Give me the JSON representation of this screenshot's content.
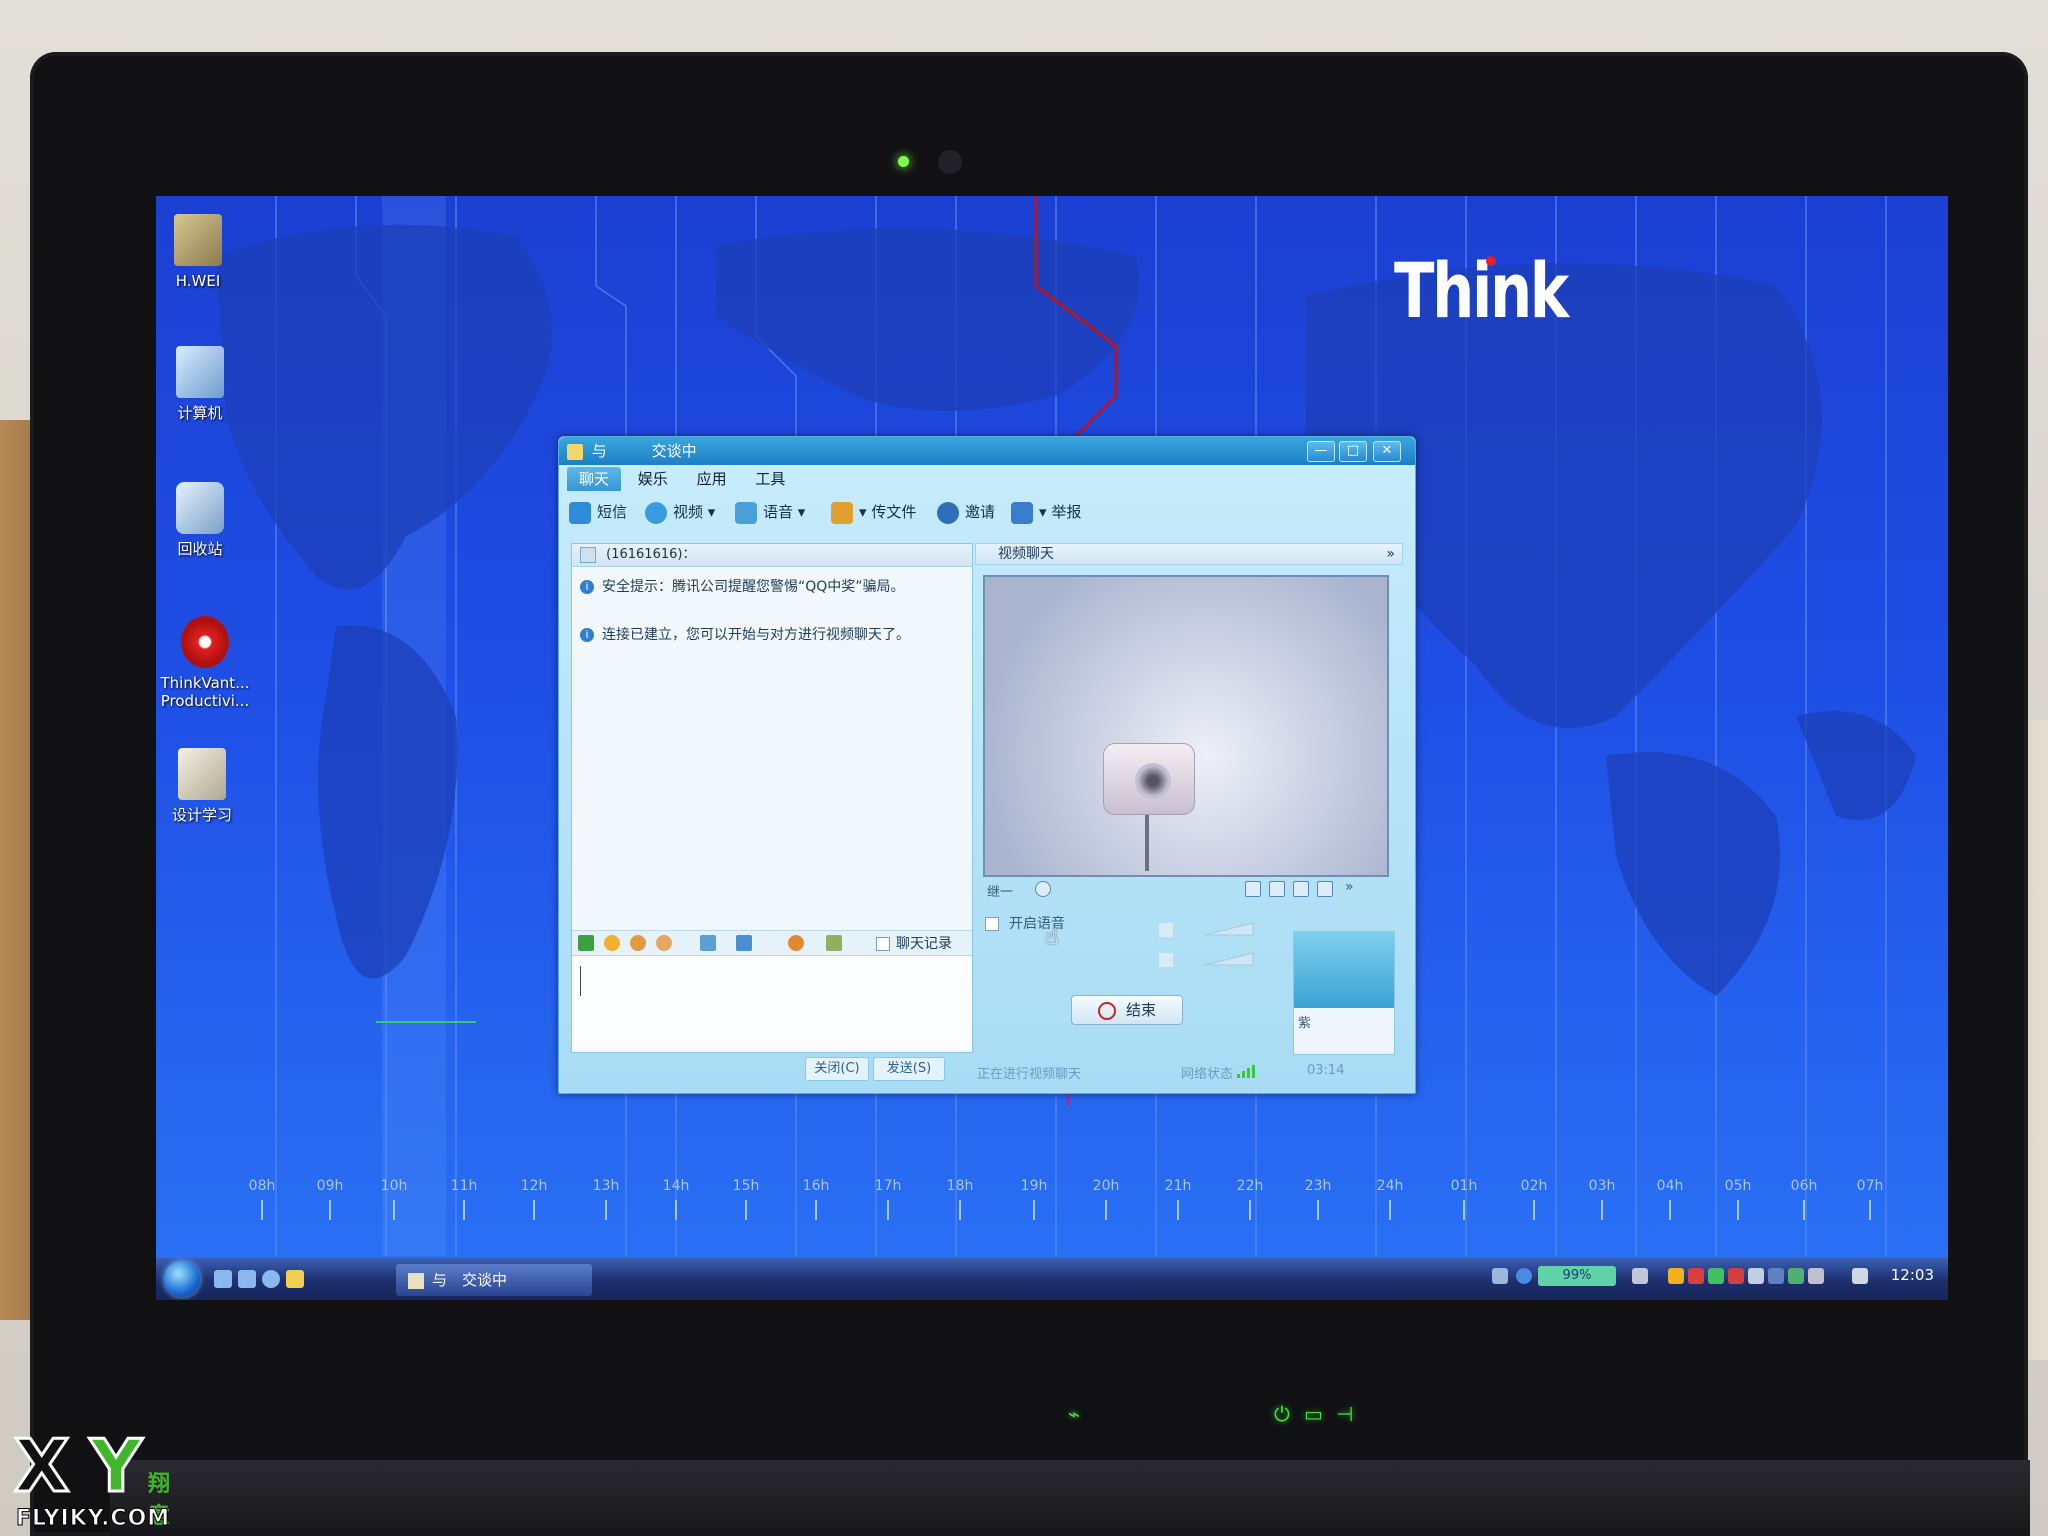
{
  "desktop": {
    "brand_logo": "Think",
    "icons": [
      {
        "label": "H.WEI",
        "icon": "folder-icon"
      },
      {
        "label": "计算机",
        "icon": "computer-icon"
      },
      {
        "label": "回收站",
        "icon": "recycle-bin-icon"
      },
      {
        "label": "ThinkVant... Productivi...",
        "icon": "thinkvantage-icon"
      },
      {
        "label": "设计学习",
        "icon": "folder-icon"
      }
    ],
    "hour_labels": [
      "08h",
      "09h",
      "10h",
      "11h",
      "12h",
      "13h",
      "14h",
      "15h",
      "16h",
      "17h",
      "18h",
      "19h",
      "20h",
      "21h",
      "22h",
      "23h",
      "24h",
      "01h",
      "02h",
      "03h",
      "04h",
      "05h",
      "06h",
      "07h"
    ]
  },
  "taskbar": {
    "task_label": "与　交谈中",
    "battery": "99%",
    "clock": "12:03"
  },
  "qq_window": {
    "title_name": "与",
    "title_status": "交谈中",
    "window_buttons": [
      "—",
      "□",
      "✕"
    ],
    "menu_tabs": [
      "聊天",
      "娱乐",
      "应用",
      "工具"
    ],
    "toolbar": [
      {
        "label": "短信",
        "icon": "sms-icon",
        "color": "#2f8bd8"
      },
      {
        "label": "视频",
        "icon": "video-icon",
        "color": "#3a9be0"
      },
      {
        "label": "语音",
        "icon": "voice-icon",
        "color": "#4aa0d8"
      },
      {
        "label": "传文件",
        "icon": "file-transfer-icon",
        "color": "#e0a030"
      },
      {
        "label": "邀请",
        "icon": "invite-icon",
        "color": "#2d6fb8"
      },
      {
        "label": "举报",
        "icon": "report-icon",
        "color": "#3b7ccc"
      }
    ],
    "chat": {
      "header": "(16161616)：",
      "messages": [
        "安全提示：腾讯公司提醒您警惕“QQ中奖”骗局。",
        "连接已建立，您可以开始与对方进行视频聊天了。"
      ],
      "history_label": "聊天记录",
      "close_button": "关闭(C)",
      "send_button": "发送(S)"
    },
    "video": {
      "header": "视频聊天",
      "remote_label": "继一",
      "voice_toggle_label": "开启语音",
      "end_button": "结束",
      "self_label": "紫",
      "status_text": "正在进行视频聊天",
      "network_label": "网络状态",
      "timer": "03:14"
    }
  },
  "watermark": {
    "x": "X",
    "y": "Y",
    "cn": "翔意",
    "url": "FLYIKY.COM"
  },
  "colors": {
    "desktop_blue": "#1f4fe6",
    "qq_title": "#1e7fc4",
    "think_red": "#e0202a"
  }
}
